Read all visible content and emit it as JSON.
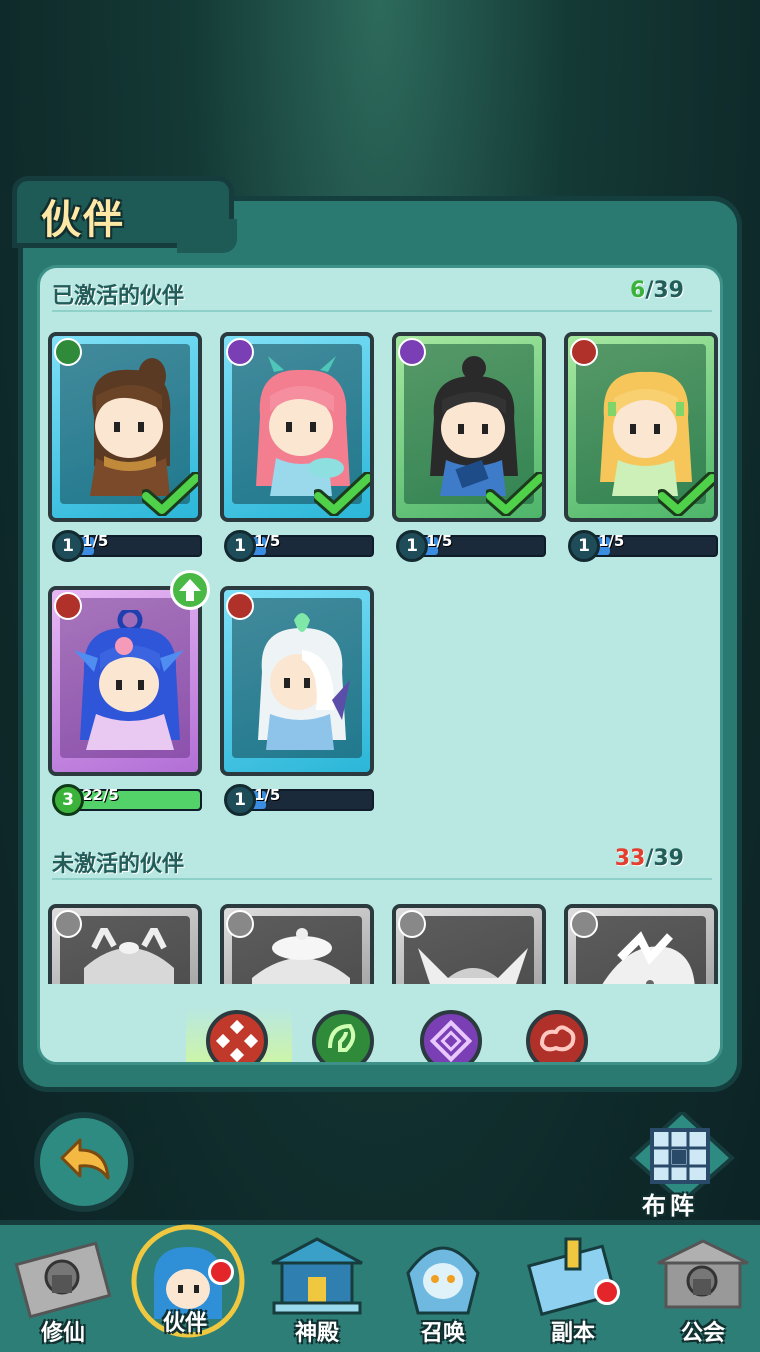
{
  "title": "伙伴",
  "activated": {
    "label": "已激活的伙伴",
    "count_current": "6",
    "count_total": "/39",
    "cards": [
      {
        "name": "brown-hair-companion",
        "frame": "blue",
        "element": "green-leaf",
        "level": "1",
        "progress": "1/5",
        "fill": 0.2,
        "checked": true
      },
      {
        "name": "pink-hair-companion",
        "frame": "blue",
        "element": "purple-swirl",
        "level": "1",
        "progress": "1/5",
        "fill": 0.2,
        "checked": true
      },
      {
        "name": "black-hair-companion",
        "frame": "green",
        "element": "purple-swirl",
        "level": "1",
        "progress": "1/5",
        "fill": 0.2,
        "checked": true
      },
      {
        "name": "blonde-companion",
        "frame": "green",
        "element": "red-cloud",
        "level": "1",
        "progress": "1/5",
        "fill": 0.2,
        "checked": true
      },
      {
        "name": "blue-hair-companion",
        "frame": "purple",
        "element": "red-cloud",
        "level": "3",
        "progress": "22/5",
        "fill": 1.0,
        "checked": false,
        "upgrade": true
      },
      {
        "name": "white-hair-companion",
        "frame": "blue",
        "element": "red-cloud",
        "level": "1",
        "progress": "1/5",
        "fill": 0.2,
        "checked": false
      }
    ]
  },
  "inactive": {
    "label": "未激活的伙伴",
    "count_current": "33",
    "count_total": "/39"
  },
  "filters": [
    {
      "name": "filter-all",
      "color": "#c0392b"
    },
    {
      "name": "filter-leaf",
      "color": "#2f8a3a"
    },
    {
      "name": "filter-swirl",
      "color": "#7b3fb5"
    },
    {
      "name": "filter-cloud",
      "color": "#b0302a"
    }
  ],
  "formation_label": "布阵",
  "nav": [
    {
      "label": "修仙",
      "locked": true
    },
    {
      "label": "伙伴",
      "active": true,
      "badge": true
    },
    {
      "label": "神殿"
    },
    {
      "label": "召唤"
    },
    {
      "label": "副本",
      "badge": true
    },
    {
      "label": "公会",
      "locked": true
    }
  ]
}
